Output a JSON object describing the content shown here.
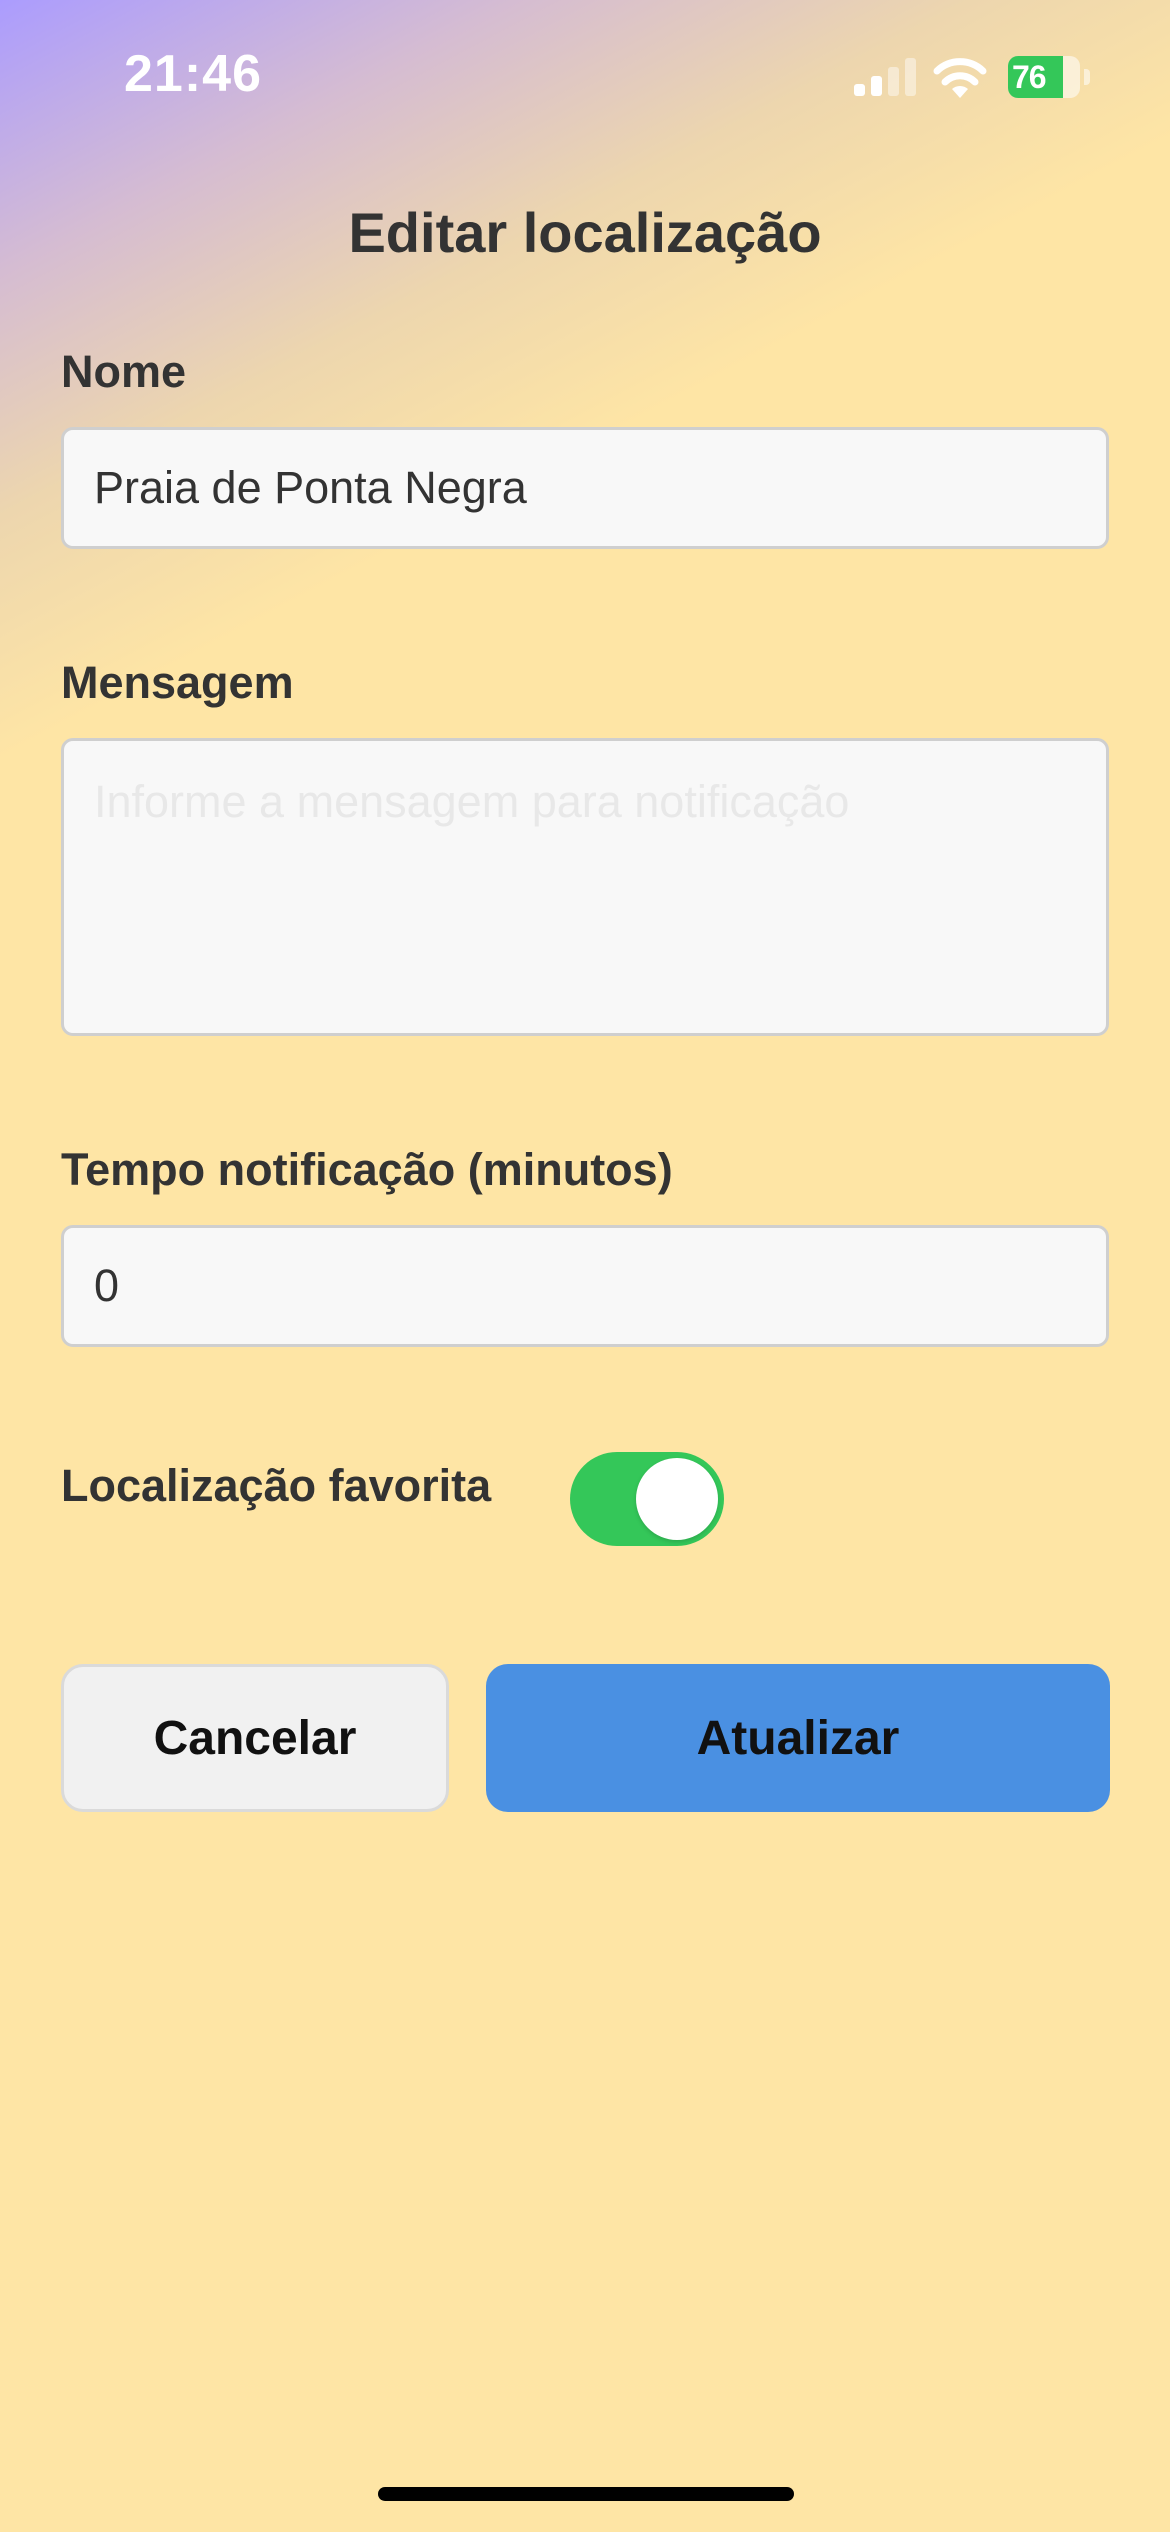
{
  "status_bar": {
    "time": "21:46",
    "battery_level": "76",
    "battery_fraction": 0.76,
    "signal_icon": "cellular-signal-icon",
    "wifi_icon": "wifi-icon",
    "battery_icon": "battery-charging-icon"
  },
  "page": {
    "title": "Editar localização"
  },
  "form": {
    "name": {
      "label": "Nome",
      "value": "Praia de Ponta Negra"
    },
    "message": {
      "label": "Mensagem",
      "value": "",
      "placeholder": "Informe a mensagem para notificação"
    },
    "notify_time": {
      "label": "Tempo notificação (minutos)",
      "value": "0"
    },
    "favorite": {
      "label": "Localização favorita",
      "checked": true
    }
  },
  "buttons": {
    "cancel_label": "Cancelar",
    "update_label": "Atualizar"
  },
  "colors": {
    "background": "#FEE5A5",
    "gradient_start": "#AB9CFE",
    "toggle_on": "#34C759",
    "primary_button": "#4A90E2",
    "secondary_button": "#F1F1F1"
  }
}
